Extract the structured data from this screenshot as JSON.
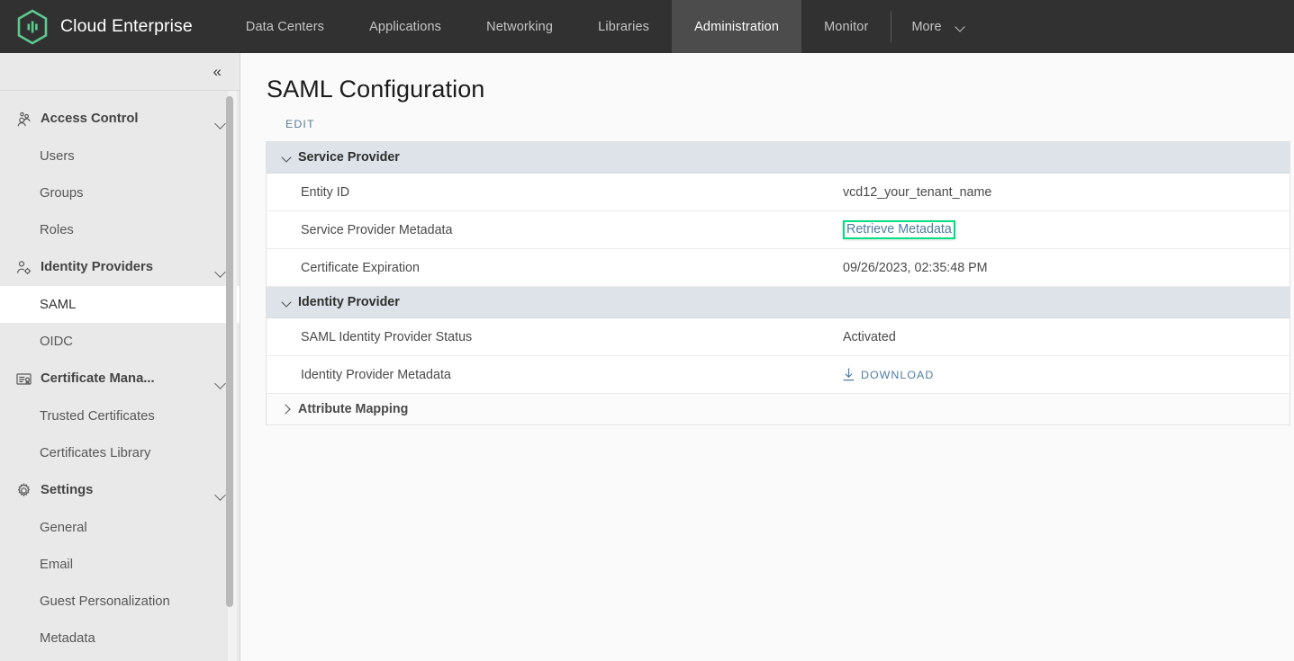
{
  "topnav": {
    "brand": "Cloud Enterprise",
    "logo_icon": "hexagon-bars-logo-icon",
    "items": [
      {
        "label": "Data Centers",
        "active": false
      },
      {
        "label": "Applications",
        "active": false
      },
      {
        "label": "Networking",
        "active": false
      },
      {
        "label": "Libraries",
        "active": false
      },
      {
        "label": "Administration",
        "active": true
      },
      {
        "label": "Monitor",
        "active": false
      }
    ],
    "more_label": "More",
    "more_icon": "chevron-down-icon",
    "active_color": "#4c4c4c",
    "bar_color": "#313131"
  },
  "sidebar": {
    "collapse_icon": "«",
    "groups": [
      {
        "label": "Access Control",
        "icon": "users-group-icon",
        "expanded": true,
        "items": [
          {
            "label": "Users",
            "active": false
          },
          {
            "label": "Groups",
            "active": false
          },
          {
            "label": "Roles",
            "active": false
          }
        ]
      },
      {
        "label": "Identity Providers",
        "icon": "user-gear-icon",
        "expanded": true,
        "items": [
          {
            "label": "SAML",
            "active": true
          },
          {
            "label": "OIDC",
            "active": false
          }
        ]
      },
      {
        "label": "Certificate Mana...",
        "icon": "certificate-icon",
        "expanded": true,
        "items": [
          {
            "label": "Trusted Certificates",
            "active": false
          },
          {
            "label": "Certificates Library",
            "active": false
          }
        ]
      },
      {
        "label": "Settings",
        "icon": "gear-icon",
        "expanded": true,
        "items": [
          {
            "label": "General",
            "active": false
          },
          {
            "label": "Email",
            "active": false
          },
          {
            "label": "Guest Personalization",
            "active": false
          },
          {
            "label": "Metadata",
            "active": false
          }
        ]
      }
    ]
  },
  "main": {
    "page_title": "SAML Configuration",
    "edit_label": "EDIT",
    "sections": [
      {
        "title": "Service Provider",
        "expanded": true,
        "rows": [
          {
            "label": "Entity ID",
            "value": "vcd12_your_tenant_name",
            "type": "text"
          },
          {
            "label": "Service Provider Metadata",
            "value": "Retrieve Metadata",
            "type": "link",
            "highlighted": true
          },
          {
            "label": "Certificate Expiration",
            "value": "09/26/2023, 02:35:48 PM",
            "type": "text"
          }
        ]
      },
      {
        "title": "Identity Provider",
        "expanded": true,
        "rows": [
          {
            "label": "SAML Identity Provider Status",
            "value": "Activated",
            "type": "text"
          },
          {
            "label": "Identity Provider Metadata",
            "value": "DOWNLOAD",
            "type": "download",
            "icon": "download-icon"
          }
        ]
      },
      {
        "title": "Attribute Mapping",
        "expanded": false,
        "rows": []
      }
    ]
  },
  "colors": {
    "highlight_green": "#00dd82",
    "link_blue": "#4f7da3",
    "section_header_bg": "#dde3e8",
    "brand_green": "#5cc98e"
  }
}
